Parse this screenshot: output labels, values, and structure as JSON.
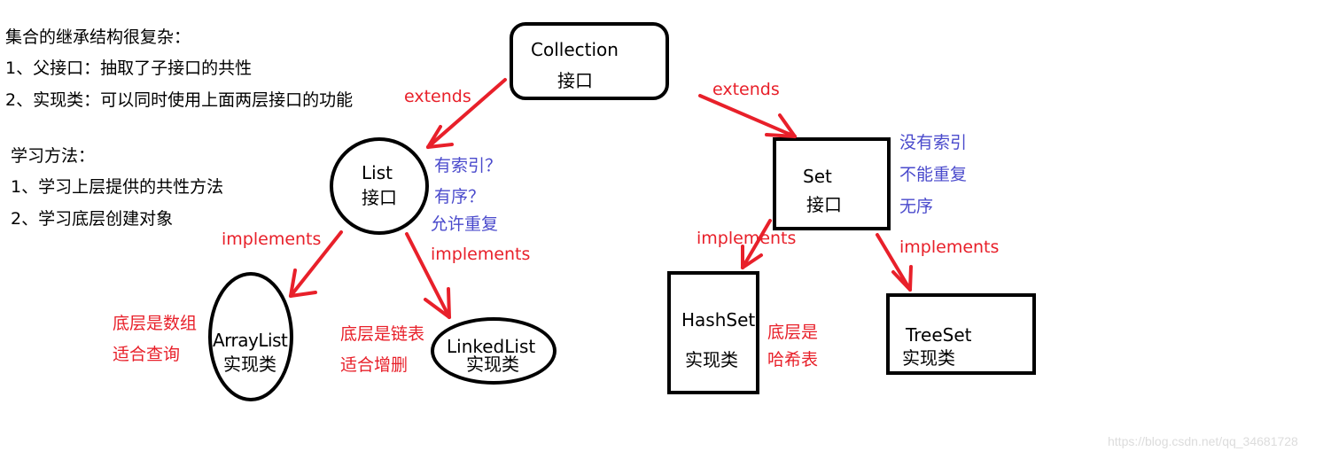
{
  "notes": {
    "title": "集合的继承结构很复杂：",
    "line1": "1、父接口：抽取了子接口的共性",
    "line2": "2、实现类：可以同时使用上面两层接口的功能",
    "method_title": "学习方法：",
    "method1": "1、学习上层提供的共性方法",
    "method2": "2、学习底层创建对象"
  },
  "nodes": {
    "collection": {
      "name": "Collection",
      "kind": "接口"
    },
    "list": {
      "name": "List",
      "kind": "接口"
    },
    "set": {
      "name": "Set",
      "kind": "接口"
    },
    "arraylist": {
      "name": "ArrayList",
      "kind": "实现类"
    },
    "linkedlist": {
      "name": "LinkedList",
      "kind": "实现类"
    },
    "hashset": {
      "name": "HashSet",
      "kind": "实现类"
    },
    "treeset": {
      "name": "TreeSet",
      "kind": "实现类"
    }
  },
  "edges": {
    "collection_list": "extends",
    "collection_set": "extends",
    "list_arraylist": "implements",
    "list_linkedlist": "implements",
    "set_hashset": "implements",
    "set_treeset": "implements"
  },
  "annotations": {
    "list_traits": [
      "有索引？",
      "有序？",
      "允许重复"
    ],
    "set_traits": [
      "没有索引",
      "不能重复",
      "无序"
    ],
    "arraylist_notes": [
      "底层是数组",
      "适合查询"
    ],
    "linkedlist_notes": [
      "底层是链表",
      "适合增删"
    ],
    "hashset_notes": [
      "底层是",
      "哈希表"
    ]
  },
  "colors": {
    "arrow": "#e8202a",
    "trait_text": "#4a4acc",
    "note_text": "#e8202a",
    "border": "#000000"
  },
  "watermark": "https://blog.csdn.net/qq_34681728"
}
